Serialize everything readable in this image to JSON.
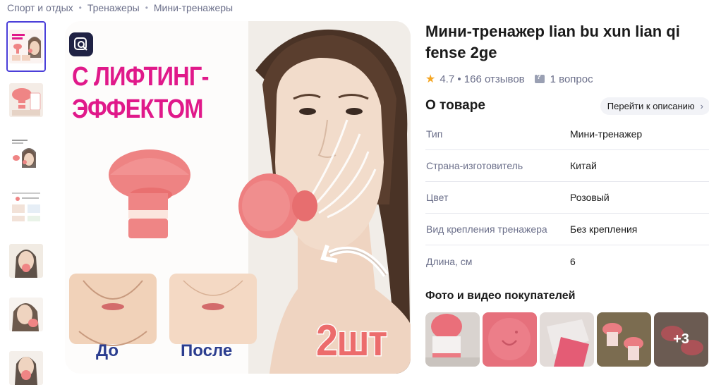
{
  "breadcrumb": [
    {
      "label": "Спорт и отдых"
    },
    {
      "label": "Тренажеры"
    },
    {
      "label": "Мини-тренажеры"
    }
  ],
  "gallery": {
    "thumbnail_count": 7,
    "active_index": 0,
    "promo_title_line1": "С ЛИФТИНГ-",
    "promo_title_line2": "ЭФФЕКТОМ",
    "label_before": "До",
    "label_after": "После",
    "label_count": "2шт"
  },
  "product": {
    "title": "Мини-тренажер lian bu xun lian qi fense 2ge",
    "rating": "4.7",
    "reviews_text": "166 отзывов",
    "questions_text": "1 вопрос"
  },
  "about": {
    "title": "О товаре",
    "to_description_label": "Перейти к описанию"
  },
  "specs": [
    {
      "key": "Тип",
      "value": "Мини-тренажер"
    },
    {
      "key": "Страна-изготовитель",
      "value": "Китай"
    },
    {
      "key": "Цвет",
      "value": "Розовый"
    },
    {
      "key": "Вид крепления тренажера",
      "value": "Без крепления"
    },
    {
      "key": "Длина, см",
      "value": "6"
    }
  ],
  "ugc": {
    "title": "Фото и видео покупателей",
    "more_label": "+3"
  },
  "colors": {
    "accent": "#4b3fd9",
    "promo_pink": "#e0198a",
    "product_pink": "#ef8585",
    "star": "#f5a623"
  }
}
